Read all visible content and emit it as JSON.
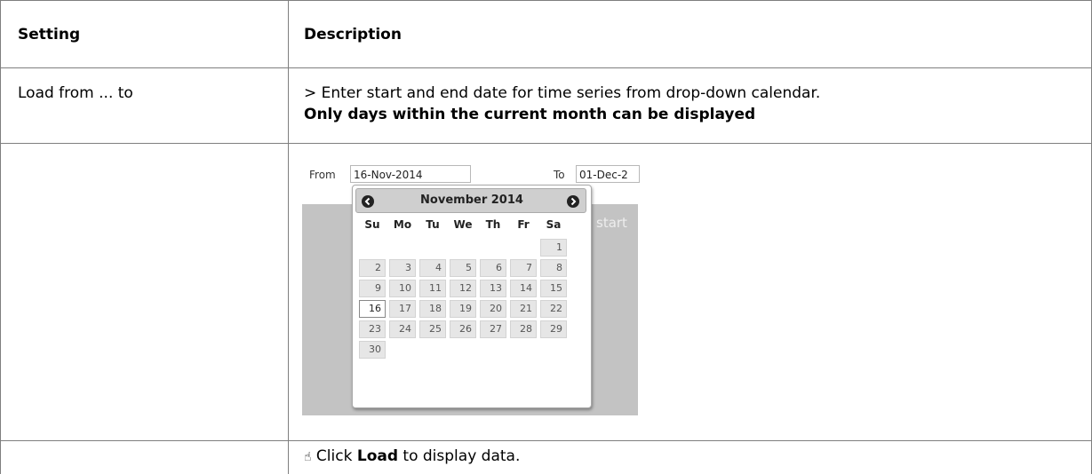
{
  "table": {
    "headers": {
      "setting": "Setting",
      "description": "Description"
    },
    "row1": {
      "setting": "Load from ... to",
      "desc_line1": "> Enter start and end date for time series from drop-down calendar.",
      "desc_line2": "Only days within the current month can be displayed"
    },
    "row3": {
      "pointer_icon": "☝",
      "prefix": " Click ",
      "bold": "Load",
      "suffix": " to display data."
    }
  },
  "screenshot": {
    "from_label": "From",
    "from_value": "16-Nov-2014",
    "to_label": "To",
    "to_value": "01-Dec-2",
    "start_text": "start",
    "datepicker": {
      "title": "November 2014",
      "prev_icon": "circle-arrow-left-icon",
      "next_icon": "circle-arrow-right-icon",
      "weekdays": [
        "Su",
        "Mo",
        "Tu",
        "We",
        "Th",
        "Fr",
        "Sa"
      ],
      "first_weekday_index": 6,
      "days": [
        "1",
        "2",
        "3",
        "4",
        "5",
        "6",
        "7",
        "8",
        "9",
        "10",
        "11",
        "12",
        "13",
        "14",
        "15",
        "16",
        "17",
        "18",
        "19",
        "20",
        "21",
        "22",
        "23",
        "24",
        "25",
        "26",
        "27",
        "28",
        "29",
        "30"
      ],
      "selected_day": "16"
    }
  }
}
